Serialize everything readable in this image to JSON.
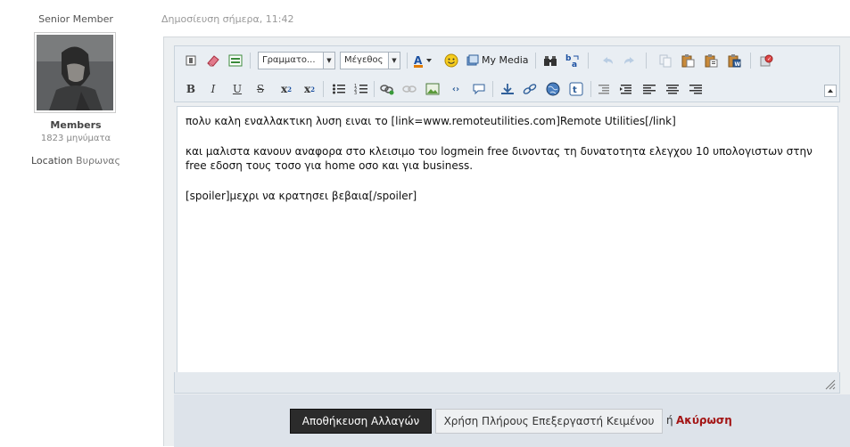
{
  "user": {
    "rank": "Senior Member",
    "name": "Members",
    "posts": "1823 μηνύματα",
    "location_label": "Location",
    "location_value": "Βυρωνας"
  },
  "post": {
    "date": "Δημοσίευση σήμερα, 11:42"
  },
  "toolbar": {
    "font_select": "Γραμματο...",
    "size_select": "Μέγεθος",
    "my_media": "My Media",
    "icons_row1": [
      "remove-format-icon",
      "eraser-icon",
      "toggle-source-icon",
      "font-color-icon",
      "smiley-icon",
      "my-media-icon",
      "find-icon",
      "replace-icon",
      "undo-icon",
      "redo-icon",
      "copy-icon",
      "paste-icon",
      "paste-text-icon",
      "paste-word-icon",
      "spellcheck-icon"
    ],
    "icons_row2": [
      "bold-icon",
      "italic-icon",
      "underline-icon",
      "strikethrough-icon",
      "subscript-icon",
      "superscript-icon",
      "unordered-list-icon",
      "ordered-list-icon",
      "link-icon",
      "unlink-icon",
      "image-icon",
      "code-icon",
      "quote-icon",
      "download-icon",
      "attach-icon",
      "globe-icon",
      "twitter-icon",
      "outdent-icon",
      "indent-icon",
      "align-left-icon",
      "align-center-icon",
      "align-right-icon",
      "collapse-icon"
    ],
    "bold_label": "B",
    "italic_label": "I",
    "underline_label": "U",
    "strike_label": "S",
    "sub_label": "x",
    "sup_label": "x"
  },
  "editor": {
    "line1": "πολυ καλη εναλλακτικη λυση ειναι το [link=www.remoteutilities.com]Remote Utilities[/link]",
    "line2": "και μαλιστα κανουν αναφορα στο κλεισιμο του logmein free δινοντας τη δυνατοτητα ελεγχου 10 υπολογιστων στην free εδοση τους τοσο για home οσο και για business.",
    "line3": "[spoiler]μεχρι να κρατησει βεβαια[/spoiler]"
  },
  "actions": {
    "save_label": "Αποθήκευση Αλλαγών",
    "full_editor_label": "Χρήση Πλήρους Επεξεργαστή Κειμένου",
    "or_text": "ή",
    "cancel_label": "Ακύρωση"
  },
  "colors": {
    "save_bg": "#2b2b2b",
    "cancel": "#a31515",
    "toolbar_bg": "#e9eef3"
  }
}
